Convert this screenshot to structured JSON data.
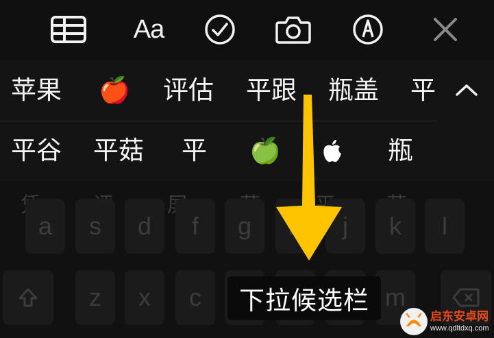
{
  "toolbar": {
    "items": [
      {
        "name": "table-icon"
      },
      {
        "name": "text-format-icon",
        "label": "Aa"
      },
      {
        "name": "checklist-icon"
      },
      {
        "name": "camera-icon"
      },
      {
        "name": "markup-pen-icon"
      },
      {
        "name": "close-icon"
      }
    ]
  },
  "candidates": {
    "row1": [
      "苹果",
      "🍎",
      "评估",
      "平跟",
      "瓶盖",
      "平"
    ],
    "row2": [
      "平谷",
      "平菇",
      "平",
      "🍏",
      "",
      "瓶"
    ],
    "apple_logo_icon": "apple-logo-icon",
    "collapse_icon": "chevron-up-icon"
  },
  "keyboard": {
    "ghost_candidates": [
      "凭",
      "评",
      "屏",
      "萍",
      "平",
      "苹"
    ],
    "row_middle": [
      "a",
      "s",
      "d",
      "f",
      "g",
      "h",
      "j",
      "k",
      "l"
    ],
    "row_bottom": [
      "z",
      "x",
      "c",
      "v",
      "b",
      "n",
      "m"
    ],
    "shift_icon": "shift-icon",
    "delete_icon": "delete-icon"
  },
  "annotation": {
    "label": "下拉候选栏",
    "arrow_color": "#FFC400"
  },
  "watermark": {
    "name": "启东安卓网",
    "url": "www.qdltdxq.com"
  },
  "colors": {
    "background": "#0D0D0D",
    "text": "#F2F2F2",
    "accent": "#FFC400"
  }
}
